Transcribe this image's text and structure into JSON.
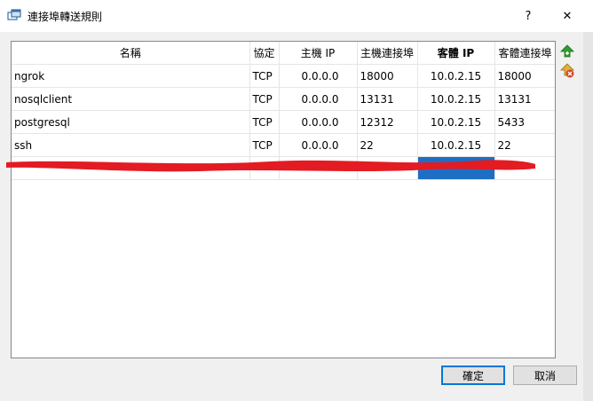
{
  "window": {
    "title": "連接埠轉送規則",
    "help": "?",
    "close": "✕"
  },
  "table": {
    "headers": [
      "名稱",
      "協定",
      "主機 IP",
      "主機連接埠",
      "客體 IP",
      "客體連接埠"
    ],
    "rows": [
      [
        "ngrok",
        "TCP",
        "0.0.0.0",
        "18000",
        "10.0.2.15",
        "18000"
      ],
      [
        "nosqlclient",
        "TCP",
        "0.0.0.0",
        "13131",
        "10.0.2.15",
        "13131"
      ],
      [
        "postgresql",
        "TCP",
        "0.0.0.0",
        "12312",
        "10.0.2.15",
        "5433"
      ],
      [
        "ssh",
        "TCP",
        "0.0.0.0",
        "22",
        "10.0.2.15",
        "22"
      ]
    ]
  },
  "buttons": {
    "ok": "確定",
    "cancel": "取消"
  },
  "colors": {
    "selection": "#1e6fc4",
    "redaction": "#e31b23",
    "add_icon": "#2e9d2e",
    "remove_icon": "#d9452a"
  },
  "icons": {
    "app": "window-icon",
    "add": "add-rule-icon",
    "remove": "remove-rule-icon"
  }
}
